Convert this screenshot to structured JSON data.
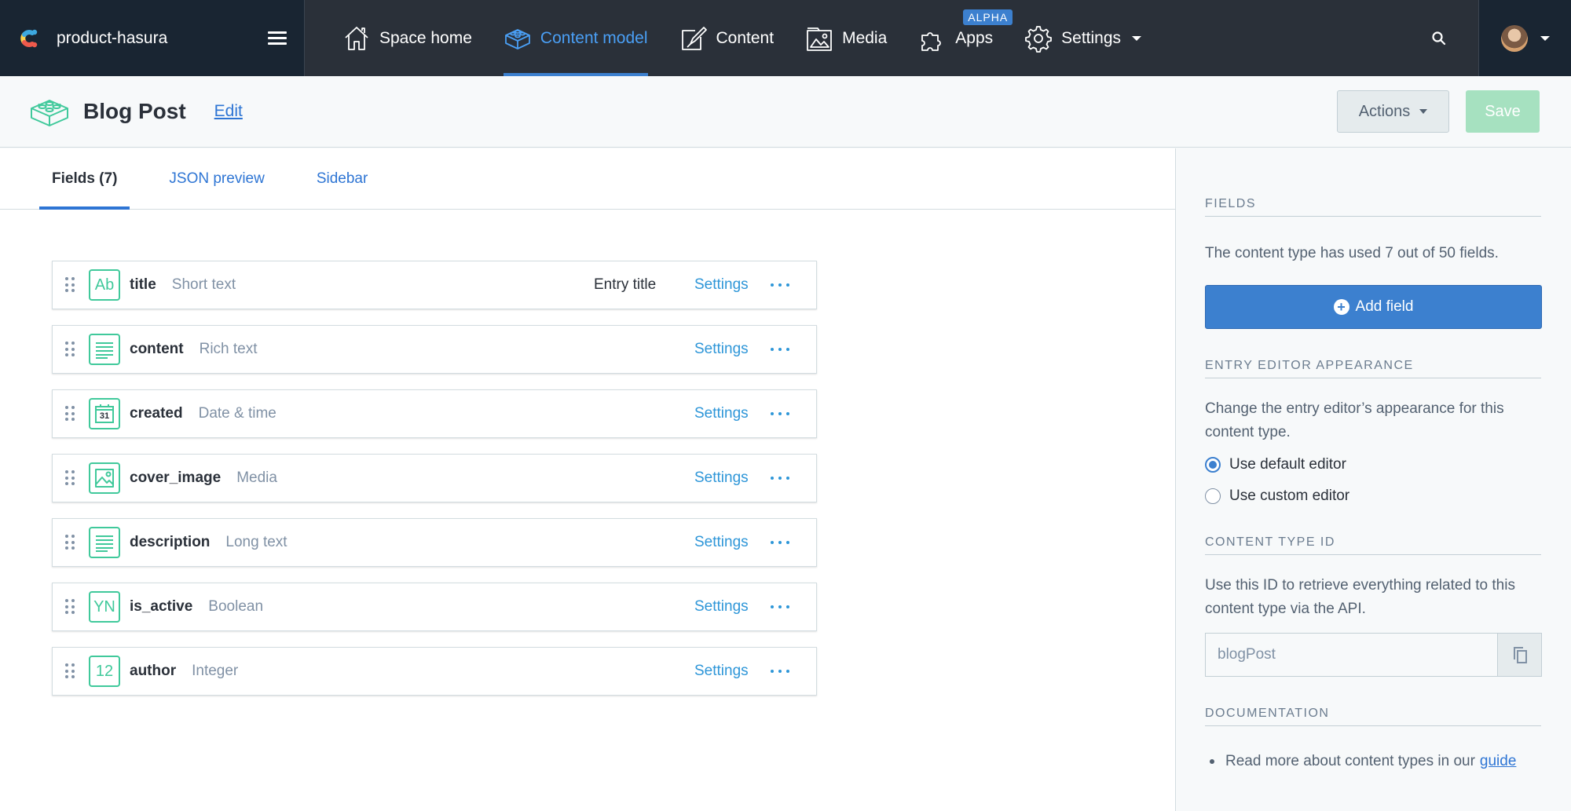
{
  "nav": {
    "space_name": "product-hasura",
    "items": [
      {
        "label": "Space home",
        "icon": "house-icon"
      },
      {
        "label": "Content model",
        "icon": "content-model-icon"
      },
      {
        "label": "Content",
        "icon": "pen-icon"
      },
      {
        "label": "Media",
        "icon": "media-icon"
      },
      {
        "label": "Apps",
        "icon": "puzzle-icon",
        "badge": "ALPHA"
      },
      {
        "label": "Settings",
        "icon": "gear-icon"
      }
    ],
    "active": "Content model"
  },
  "header": {
    "title": "Blog Post",
    "edit_label": "Edit",
    "actions_label": "Actions",
    "save_label": "Save"
  },
  "tabs": [
    {
      "label": "Fields (7)"
    },
    {
      "label": "JSON preview"
    },
    {
      "label": "Sidebar"
    }
  ],
  "fields": [
    {
      "name": "title",
      "type": "Short text",
      "icon_text": "Ab",
      "entry_title": "Entry title",
      "settings": "Settings"
    },
    {
      "name": "content",
      "type": "Rich text",
      "icon": "rich-text-icon",
      "settings": "Settings"
    },
    {
      "name": "created",
      "type": "Date & time",
      "icon_text": "31",
      "settings": "Settings"
    },
    {
      "name": "cover_image",
      "type": "Media",
      "icon": "image-icon",
      "settings": "Settings"
    },
    {
      "name": "description",
      "type": "Long text",
      "icon": "long-text-icon",
      "settings": "Settings"
    },
    {
      "name": "is_active",
      "type": "Boolean",
      "icon_text": "YN",
      "settings": "Settings"
    },
    {
      "name": "author",
      "type": "Integer",
      "icon_text": "12",
      "settings": "Settings"
    }
  ],
  "sidebar": {
    "fields_title": "FIELDS",
    "fields_text": "The content type has used 7 out of 50 fields.",
    "add_field_label": "Add field",
    "appearance_title": "ENTRY EDITOR APPEARANCE",
    "appearance_text": "Change the entry editor’s appearance for this content type.",
    "option_default": "Use default editor",
    "option_custom": "Use custom editor",
    "selected_option": "Use default editor",
    "id_title": "CONTENT TYPE ID",
    "id_text": "Use this ID to retrieve everything related to this content type via the API.",
    "id_value": "blogPost",
    "doc_title": "DOCUMENTATION",
    "doc_text": "Read more about content types in our",
    "doc_link": "guide"
  },
  "colors": {
    "nav_bg": "#2a3039",
    "accent": "#3c80cf",
    "field_icon": "#40c99b",
    "save_disabled": "#a6e1c0"
  }
}
